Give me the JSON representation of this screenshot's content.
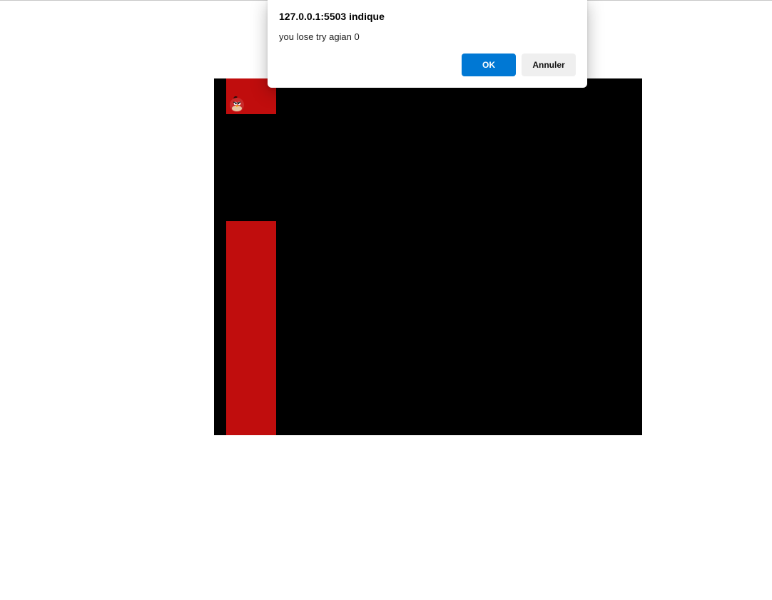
{
  "dialog": {
    "title": "127.0.0.1:5503 indique",
    "message": "you lose try agian 0",
    "ok_label": "OK",
    "cancel_label": "Annuler"
  },
  "game": {
    "background_color": "#000000",
    "pipe_color": "#c00d0d",
    "bird_icon": "red-angry-bird-icon"
  },
  "colors": {
    "ok_button": "#0078d4",
    "cancel_button": "#efefef"
  }
}
